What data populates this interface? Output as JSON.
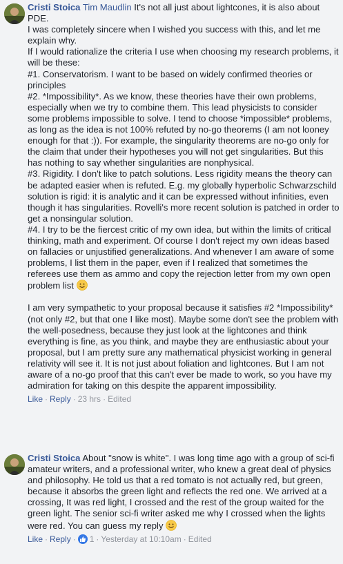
{
  "comments": [
    {
      "author": "Cristi Stoica",
      "mention": "Tim Maudlin",
      "paragraphs": [
        "It's not all just about lightcones, it is also about PDE.\nI was completely sincere when I wished you success with this, and let me explain why.\nIf I would rationalize the criteria I use when choosing my research problems, it will be these:\n#1. Conservatorism. I want to be based on widely confirmed theories or principles\n#2. *Impossibility*. As we know, these theories have their own problems, especially when we try to combine them. This lead physicists to consider some problems impossible to solve. I tend to choose *impossible* problems, as long as the idea is not 100% refuted by no-go theorems (I am not looney enough for that :)). For example, the singularity theorems are no-go only for the claim that under their hypotheses you will not get singularities. But this has nothing to say whether singularities are nonphysical.\n#3. Rigidity. I don't like to patch solutions. Less rigidity means the theory can be adapted easier when is refuted. E.g. my globally hyperbolic Schwarzschild solution is rigid: it is analytic and it can be expressed without infinities, even though it has singularities. Rovelli's more recent solution is patched in order to get a nonsingular solution.\n#4. I try to be the fiercest critic of my own idea, but within the limits of critical thinking, math and experiment. Of course I don't reject my own ideas based on fallacies or unjustified generalizations. And whenever I am aware of some problems, I list them in the paper, even if I realized that sometimes the referees use them as ammo and copy the rejection letter from my own open problem list",
        "I am very sympathetic to your proposal because it satisfies #2 *Impossibility* (not only #2, but that one I like most). Maybe some don't see the problem with the well-posedness, because they just look at the lightcones and think everything is fine, as you think, and maybe they are enthusiastic about your proposal, but I am pretty sure any mathematical physicist working in general relativity will see it. It is not just about foliation and lightcones. But I am not aware of a no-go proof that this can't ever be made to work, so you have my admiration for taking on this despite the apparent impossibility."
      ],
      "actions": {
        "like": "Like",
        "reply": "Reply",
        "time": "23 hrs",
        "edited": "Edited"
      }
    },
    {
      "author": "Cristi Stoica",
      "text": "About \"snow is white\". I was long time ago with a group of sci-fi amateur writers, and a professional writer, who knew a great deal of physics and philosophy. He told us that a red tomato is not actually red, but green, because it absorbs the green light and reflects the red one. We arrived at a crossing, It was red light, I crossed and the rest of the group waited for the green light. The senior sci-fi writer asked me why I crossed when the lights were red. You can guess my reply",
      "actions": {
        "like": "Like",
        "reply": "Reply",
        "like_count": "1",
        "time": "Yesterday at 10:10am",
        "edited": "Edited"
      }
    }
  ],
  "icons": {
    "emoji": "smiley-emoji-icon",
    "like_badge": "thumbs-up-icon"
  },
  "colors": {
    "link": "#385898",
    "meta": "#90949c",
    "text": "#1d2129",
    "background": "#f2f3f5",
    "like_badge": "#3578e5"
  }
}
